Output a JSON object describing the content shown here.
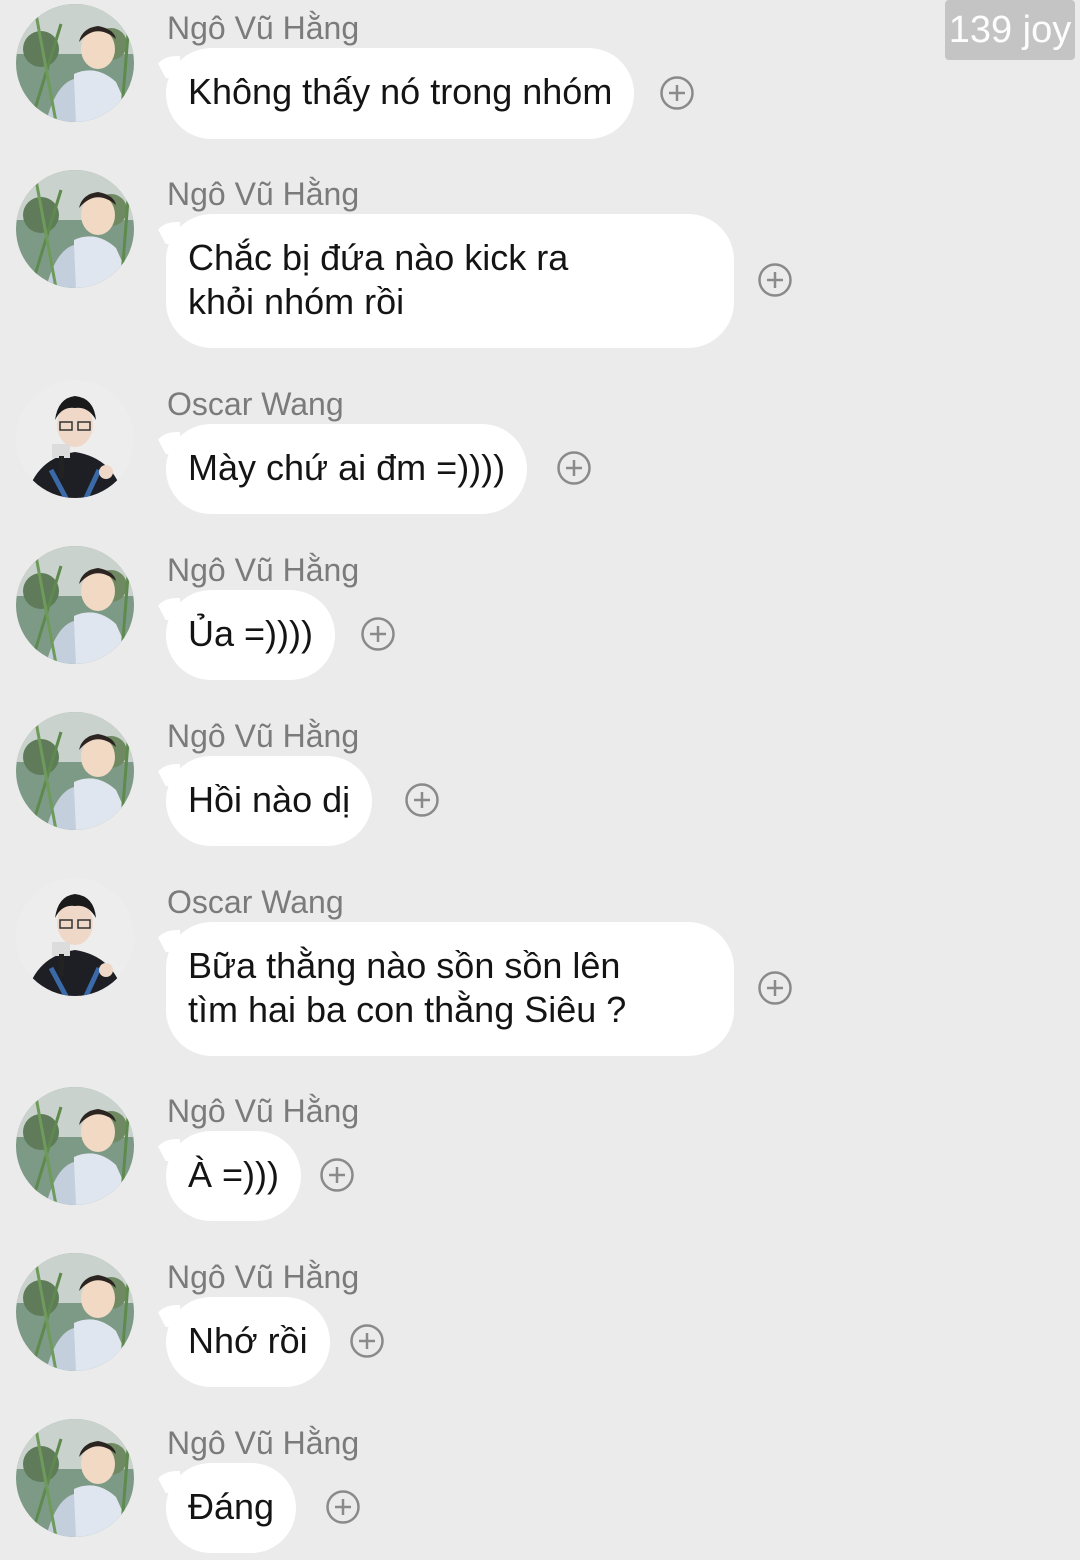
{
  "watermark": "139 joy",
  "messages": [
    {
      "sender": "Ngô Vũ Hằng",
      "text": "Không thấy nó trong nhóm",
      "avatar_icon": "user-avatar-hang-icon"
    },
    {
      "sender": "Ngô Vũ Hằng",
      "text": "Chắc bị đứa nào kick ra khỏi nhóm rồi",
      "avatar_icon": "user-avatar-hang-icon"
    },
    {
      "sender": "Oscar Wang",
      "text": "Mày chứ ai đm =))))",
      "avatar_icon": "user-avatar-oscar-icon"
    },
    {
      "sender": "Ngô Vũ Hằng",
      "text": "Ủa =))))",
      "avatar_icon": "user-avatar-hang-icon"
    },
    {
      "sender": "Ngô Vũ Hằng",
      "text": "Hồi nào dị",
      "avatar_icon": "user-avatar-hang-icon"
    },
    {
      "sender": "Oscar Wang",
      "text": "Bữa thằng nào sồn sồn lên tìm hai ba con thằng Siêu ?",
      "avatar_icon": "user-avatar-oscar-icon"
    },
    {
      "sender": "Ngô Vũ Hằng",
      "text": "À =)))",
      "avatar_icon": "user-avatar-hang-icon"
    },
    {
      "sender": "Ngô Vũ Hằng",
      "text": "Nhớ rồi",
      "avatar_icon": "user-avatar-hang-icon"
    },
    {
      "sender": "Ngô Vũ Hằng",
      "text": "Đáng",
      "avatar_icon": "user-avatar-hang-icon"
    }
  ],
  "colors": {
    "background": "#ebebeb",
    "bubble": "#ffffff",
    "sender_text": "#7b7b7b",
    "message_text": "#141414",
    "react_icon": "#8a8a8a"
  }
}
